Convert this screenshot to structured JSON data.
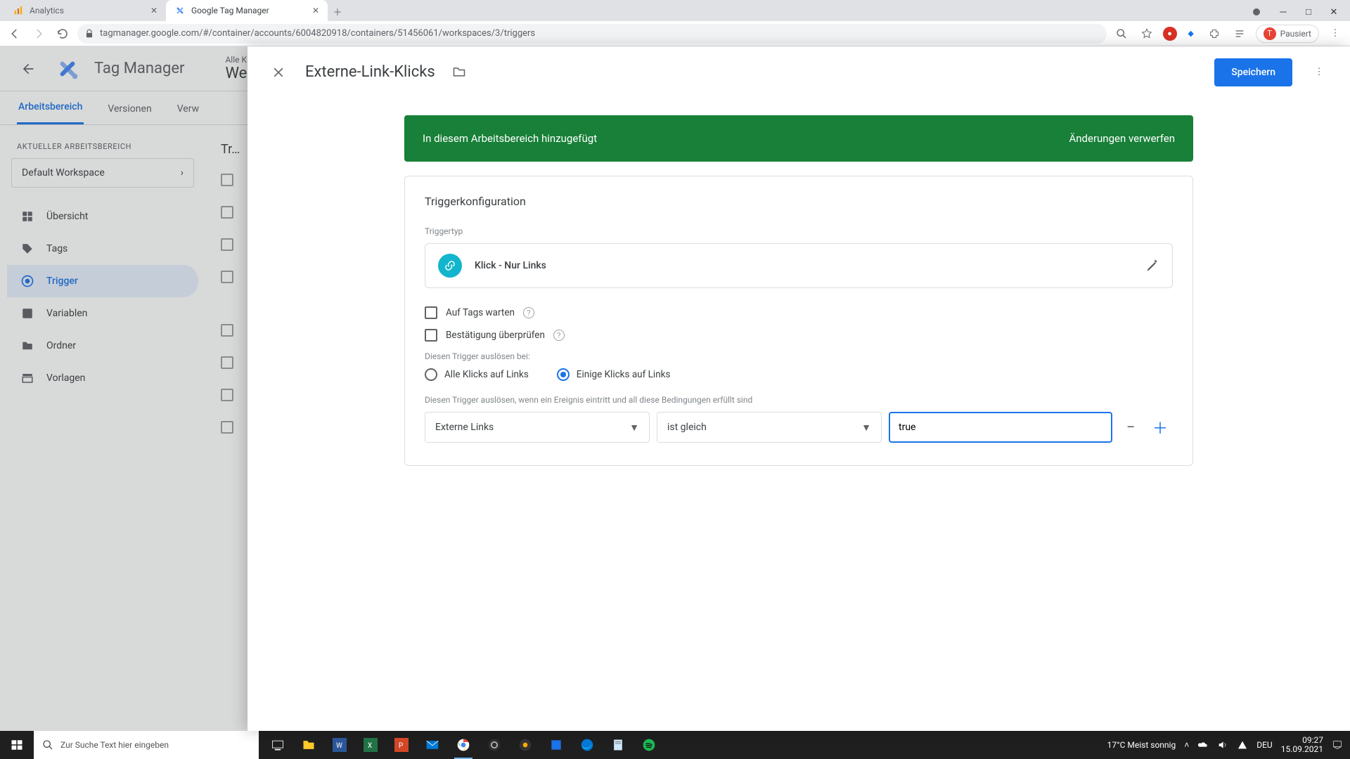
{
  "browser": {
    "tabs": [
      {
        "title": "Analytics",
        "favicon": "analytics"
      },
      {
        "title": "Google Tag Manager",
        "favicon": "gtm"
      }
    ],
    "url": "tagmanager.google.com/#/container/accounts/6004820918/containers/51456061/workspaces/3/triggers",
    "profile_status": "Pausiert",
    "profile_initial": "T"
  },
  "gtm": {
    "product": "Tag Manager",
    "breadcrumb_small": "Alle K…",
    "breadcrumb_big": "We…",
    "tabs": {
      "workspace": "Arbeitsbereich",
      "versions": "Versionen",
      "admin": "Verw"
    },
    "workspace_label": "AKTUELLER ARBEITSBEREICH",
    "workspace_name": "Default Workspace",
    "side": {
      "overview": "Übersicht",
      "tags": "Tags",
      "trigger": "Trigger",
      "variables": "Variablen",
      "folders": "Ordner",
      "templates": "Vorlagen"
    },
    "list_heading": "Tr…"
  },
  "modal": {
    "title": "Externe-Link-Klicks",
    "save": "Speichern",
    "banner_text": "In diesem Arbeitsbereich hinzugefügt",
    "banner_discard": "Änderungen verwerfen",
    "card_heading": "Triggerkonfiguration",
    "type_label": "Triggertyp",
    "type_value": "Klick - Nur Links",
    "wait_tags": "Auf Tags warten",
    "check_validation": "Bestätigung überprüfen",
    "fire_on_label": "Diesen Trigger auslösen bei:",
    "radio_all": "Alle Klicks auf Links",
    "radio_some": "Einige Klicks auf Links",
    "cond_label": "Diesen Trigger auslösen, wenn ein Ereignis eintritt und all diese Bedingungen erfüllt sind",
    "cond_var": "Externe Links",
    "cond_op": "ist gleich",
    "cond_val": "true"
  },
  "taskbar": {
    "search_placeholder": "Zur Suche Text hier eingeben",
    "weather": "17°C  Meist sonnig",
    "lang": "DEU",
    "time": "09:27",
    "date": "15.09.2021"
  }
}
